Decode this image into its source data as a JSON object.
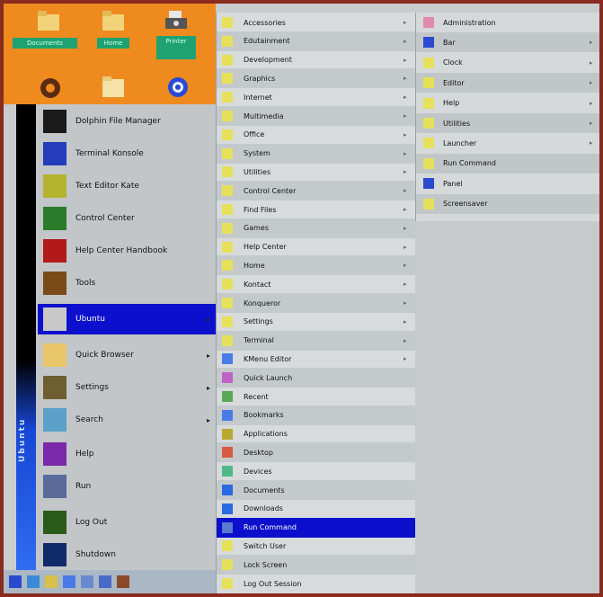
{
  "desktop": {
    "icons": [
      {
        "name": "folder-icon",
        "label": "Documents",
        "color": "#f2d37a"
      },
      {
        "name": "folder-icon",
        "label": "Home",
        "color": "#f2d37a"
      },
      {
        "name": "printer-icon",
        "label": "Printer",
        "color": "#6b6b6b"
      },
      {
        "name": "ubuntu-icon",
        "label": "",
        "color": "#5a2a12"
      },
      {
        "name": "folder-icon",
        "label": "",
        "color": "#f4e2a8"
      },
      {
        "name": "globe-icon",
        "label": "",
        "color": "#2849d8"
      }
    ]
  },
  "start_menu": {
    "sidebar_label": "Ubuntu",
    "items": [
      {
        "label": "Dolphin File Manager",
        "icon": "file-manager-icon",
        "color": "#1a1a1a",
        "submenu": false,
        "selected": false
      },
      {
        "label": "Terminal Konsole",
        "icon": "terminal-icon",
        "color": "#233dbb",
        "submenu": false,
        "selected": false
      },
      {
        "label": "Text Editor Kate",
        "icon": "text-editor-icon",
        "color": "#b6b32f",
        "submenu": false,
        "selected": false
      },
      {
        "label": "Control Center",
        "icon": "control-center-icon",
        "color": "#2a7b2a",
        "submenu": false,
        "selected": false
      },
      {
        "label": "Help Center Handbook",
        "icon": "help-icon",
        "color": "#b21a1a",
        "submenu": false,
        "selected": false
      },
      {
        "label": "Tools",
        "icon": "tools-icon",
        "color": "#7a4a18",
        "submenu": false,
        "selected": false
      },
      {
        "label": "Ubuntu",
        "icon": "ubuntu-menu-icon",
        "color": "#c8c8c8",
        "submenu": true,
        "selected": true
      },
      {
        "label": "Quick Browser",
        "icon": "folder-icon",
        "color": "#e9c66a",
        "submenu": true,
        "selected": false
      },
      {
        "label": "Settings",
        "icon": "settings-icon",
        "color": "#6f5f30",
        "submenu": true,
        "selected": false
      },
      {
        "label": "Search",
        "icon": "search-icon",
        "color": "#5aa0c8",
        "submenu": true,
        "selected": false
      },
      {
        "label": "Help",
        "icon": "help-book-icon",
        "color": "#7a2aa8",
        "submenu": false,
        "selected": false
      },
      {
        "label": "Run",
        "icon": "run-icon",
        "color": "#5a6a9a",
        "submenu": false,
        "selected": false
      },
      {
        "label": "Log Out",
        "icon": "logout-icon",
        "color": "#2c5a1a",
        "submenu": false,
        "selected": false
      },
      {
        "label": "Shutdown",
        "icon": "shutdown-icon",
        "color": "#102a6a",
        "submenu": false,
        "selected": false
      }
    ]
  },
  "submenu1": {
    "items": [
      {
        "label": "Accessories",
        "icon": "accessories-icon",
        "submenu": true
      },
      {
        "label": "Edutainment",
        "icon": "edu-icon",
        "submenu": true
      },
      {
        "label": "Development",
        "icon": "dev-icon",
        "submenu": true
      },
      {
        "label": "Graphics",
        "icon": "graphics-icon",
        "submenu": true
      },
      {
        "label": "Internet",
        "icon": "internet-icon",
        "submenu": true
      },
      {
        "label": "Multimedia",
        "icon": "multimedia-icon",
        "submenu": true
      },
      {
        "label": "Office",
        "icon": "office-icon",
        "submenu": true
      },
      {
        "label": "System",
        "icon": "system-icon",
        "submenu": true
      },
      {
        "label": "Utilities",
        "icon": "utilities-icon",
        "submenu": true
      },
      {
        "label": "Control Center",
        "icon": "control-icon",
        "submenu": true
      },
      {
        "label": "Find Files",
        "icon": "find-icon",
        "submenu": true
      },
      {
        "label": "Games",
        "icon": "games-icon",
        "submenu": true
      },
      {
        "label": "Help Center",
        "icon": "help-icon",
        "submenu": true
      },
      {
        "label": "Home",
        "icon": "home-icon",
        "submenu": true
      },
      {
        "label": "Kontact",
        "icon": "kontact-icon",
        "submenu": true
      },
      {
        "label": "Konqueror",
        "icon": "konqueror-icon",
        "submenu": true
      },
      {
        "label": "Settings",
        "icon": "settings-icon",
        "submenu": true
      },
      {
        "label": "Terminal",
        "icon": "terminal-icon",
        "submenu": true
      },
      {
        "label": "KMenu Editor",
        "icon": "kmenu-icon",
        "submenu": true
      },
      {
        "label": "Quick Launch",
        "icon": "quick-icon",
        "submenu": false
      },
      {
        "label": "Recent",
        "icon": "recent-icon",
        "submenu": false
      },
      {
        "label": "Bookmarks",
        "icon": "bookmarks-icon",
        "submenu": false
      },
      {
        "label": "Applications",
        "icon": "apps-icon",
        "submenu": false
      },
      {
        "label": "Desktop",
        "icon": "desktop-icon",
        "submenu": false
      },
      {
        "label": "Devices",
        "icon": "devices-icon",
        "submenu": false
      },
      {
        "label": "Documents",
        "icon": "documents-icon",
        "submenu": false
      },
      {
        "label": "Downloads",
        "icon": "downloads-icon",
        "submenu": false
      },
      {
        "label": "Run Command",
        "icon": "run-icon",
        "submenu": false,
        "selected": true
      },
      {
        "label": "Switch User",
        "icon": "switch-icon",
        "submenu": false
      },
      {
        "label": "Lock Screen",
        "icon": "lock-icon",
        "submenu": false
      },
      {
        "label": "Log Out Session",
        "icon": "logout-icon",
        "submenu": false
      }
    ]
  },
  "submenu2": {
    "items": [
      {
        "label": "Administration",
        "icon": "admin-icon",
        "submenu": false
      },
      {
        "label": "Bar",
        "icon": "bar-icon",
        "submenu": true
      },
      {
        "label": "Clock",
        "icon": "clock-icon",
        "submenu": true
      },
      {
        "label": "Editor",
        "icon": "editor-icon",
        "submenu": true
      },
      {
        "label": "Help",
        "icon": "help-icon",
        "submenu": true
      },
      {
        "label": "Utilities",
        "icon": "utilities-icon",
        "submenu": true
      },
      {
        "label": "Launcher",
        "icon": "launcher-icon",
        "submenu": true
      },
      {
        "label": "Run Command",
        "icon": "run-icon",
        "submenu": false
      },
      {
        "label": "Panel",
        "icon": "panel-icon",
        "submenu": false
      },
      {
        "label": "Screensaver",
        "icon": "screensaver-icon",
        "submenu": false
      }
    ]
  },
  "taskbar": {
    "items": [
      "start-button-icon",
      "browser-icon",
      "folder-icon",
      "terminal-icon",
      "editor-icon",
      "settings-icon",
      "clock-icon"
    ]
  },
  "colors": {
    "selection": "#0c10cc",
    "desktop": "#ee8a1e",
    "menu_bg": "#c2c6c8",
    "frame": "#8a2b1f"
  }
}
